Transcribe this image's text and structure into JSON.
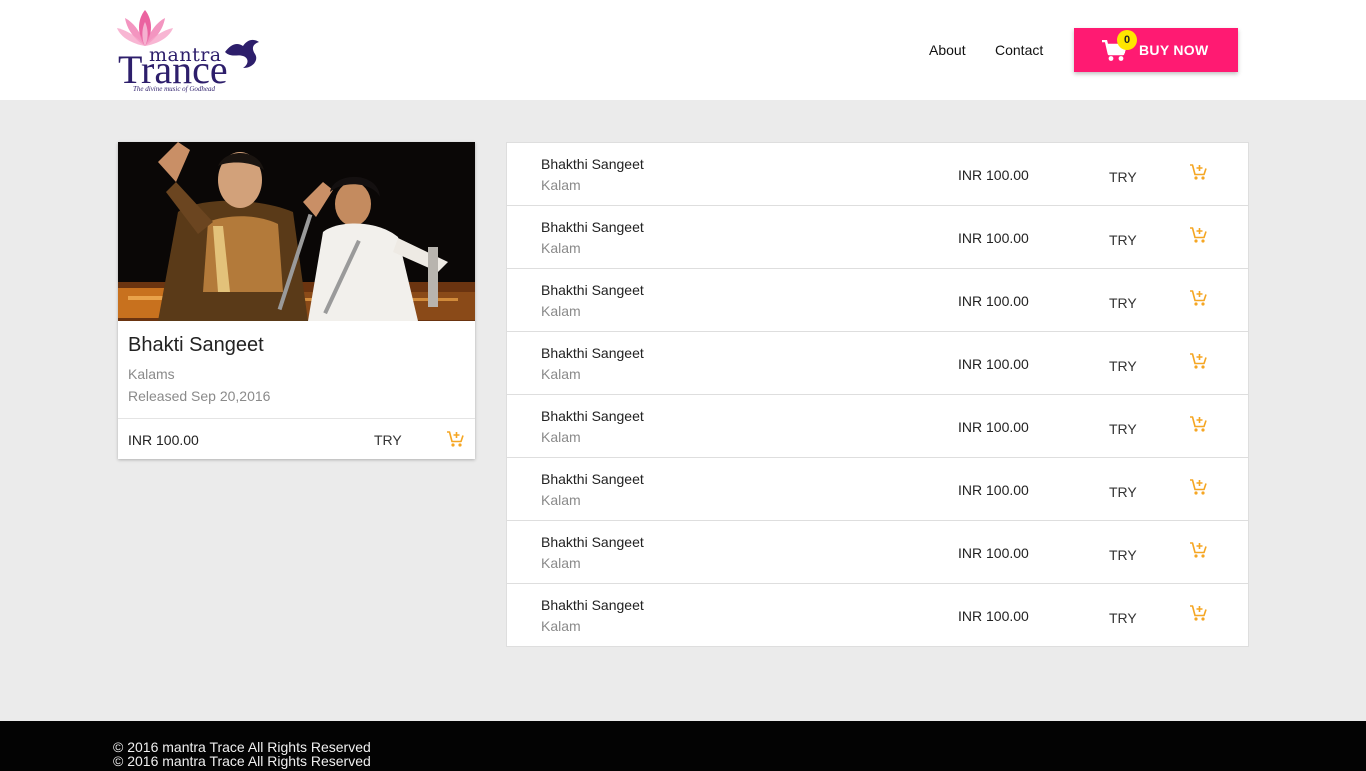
{
  "header": {
    "logo": {
      "word1": "mantra",
      "word2": "Trance",
      "tagline": "The divine music of Godhead"
    },
    "nav": [
      {
        "label": "About"
      },
      {
        "label": "Contact"
      }
    ],
    "buy_button": {
      "label": "BUY NOW",
      "cart_count": "0",
      "icon": "shopping-cart-icon"
    }
  },
  "featured": {
    "title": "Bhakti Sangeet",
    "subtitle": "Kalams",
    "released": "Released Sep 20,2016",
    "price": "INR 100.00",
    "try_label": "TRY",
    "cart_icon": "add-to-cart-icon"
  },
  "tracks": [
    {
      "title": "Bhakthi Sangeet",
      "subtitle": "Kalam",
      "price": "INR 100.00",
      "try_label": "TRY"
    },
    {
      "title": "Bhakthi Sangeet",
      "subtitle": "Kalam",
      "price": "INR 100.00",
      "try_label": "TRY"
    },
    {
      "title": "Bhakthi Sangeet",
      "subtitle": "Kalam",
      "price": "INR 100.00",
      "try_label": "TRY"
    },
    {
      "title": "Bhakthi Sangeet",
      "subtitle": "Kalam",
      "price": "INR 100.00",
      "try_label": "TRY"
    },
    {
      "title": "Bhakthi Sangeet",
      "subtitle": "Kalam",
      "price": "INR 100.00",
      "try_label": "TRY"
    },
    {
      "title": "Bhakthi Sangeet",
      "subtitle": "Kalam",
      "price": "INR 100.00",
      "try_label": "TRY"
    },
    {
      "title": "Bhakthi Sangeet",
      "subtitle": "Kalam",
      "price": "INR 100.00",
      "try_label": "TRY"
    },
    {
      "title": "Bhakthi Sangeet",
      "subtitle": "Kalam",
      "price": "INR 100.00",
      "try_label": "TRY"
    }
  ],
  "footer": {
    "copyright": "© 2016 mantra Trace All Rights Reserved"
  },
  "colors": {
    "accent": "#ff1a72",
    "badge": "#ffe600",
    "cart_icon": "#f5a623",
    "logo": "#2d1e6b",
    "background": "#ebebeb"
  }
}
